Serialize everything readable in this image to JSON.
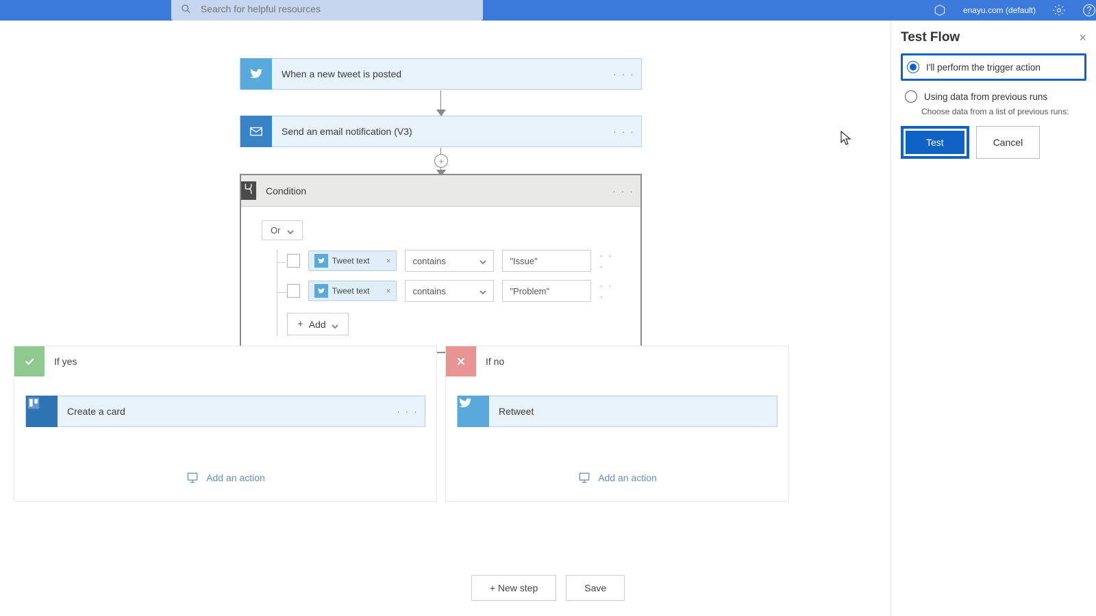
{
  "header": {
    "search_placeholder": "Search for helpful resources",
    "env_label": "enayu.com (default)"
  },
  "flow": {
    "step1": "When a new tweet is posted",
    "step2": "Send an email notification (V3)",
    "condition": {
      "title": "Condition",
      "logic": "Or",
      "rows": [
        {
          "token": "Tweet text",
          "op": "contains",
          "value": "\"Issue\""
        },
        {
          "token": "Tweet text",
          "op": "contains",
          "value": "\"Problem\""
        }
      ],
      "add_label": "Add"
    },
    "yes": {
      "title": "If yes",
      "action": "Create a card",
      "add_action": "Add an action"
    },
    "no": {
      "title": "If no",
      "action": "Retweet",
      "add_action": "Add an action"
    },
    "new_step": "+ New step",
    "save": "Save"
  },
  "panel": {
    "title": "Test Flow",
    "opt1": "I'll perform the trigger action",
    "opt2": "Using data from previous runs",
    "sub": "Choose data from a list of previous runs:",
    "test": "Test",
    "cancel": "Cancel"
  }
}
